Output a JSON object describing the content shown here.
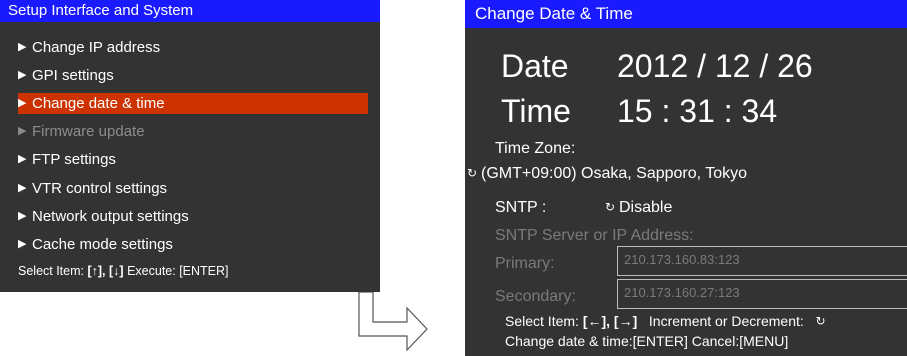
{
  "left_panel": {
    "title": "Setup Interface and System",
    "items": [
      {
        "label": "Change IP address",
        "selected": false,
        "disabled": false
      },
      {
        "label": "GPI settings",
        "selected": false,
        "disabled": false
      },
      {
        "label": "Change date & time",
        "selected": true,
        "disabled": false
      },
      {
        "label": "Firmware update",
        "selected": false,
        "disabled": true
      },
      {
        "label": "FTP settings",
        "selected": false,
        "disabled": false
      },
      {
        "label": "VTR control settings",
        "selected": false,
        "disabled": false
      },
      {
        "label": "Network output settings",
        "selected": false,
        "disabled": false
      },
      {
        "label": "Cache mode settings",
        "selected": false,
        "disabled": false
      }
    ],
    "footer": {
      "select_label": "Select Item:",
      "select_keys": "[↑], [↓]",
      "execute_label": "Execute: [ENTER]"
    }
  },
  "right_panel": {
    "title": "Change Date & Time",
    "date_label": "Date",
    "date_value": "2012 / 12 / 26",
    "time_label": "Time",
    "time_value": "15 : 31 : 34",
    "time_zone_label": "Time Zone:",
    "time_zone_value": "(GMT+09:00) Osaka, Sapporo, Tokyo",
    "sntp_label": "SNTP :",
    "sntp_value": "Disable",
    "server_label": "SNTP Server or IP Address:",
    "primary_label": "Primary:",
    "primary_value": "210.173.160.83:123",
    "secondary_label": "Secondary:",
    "secondary_value": "210.173.160.27:123",
    "footer": {
      "select_label": "Select Item:",
      "select_keys": "[←], [→]",
      "increment_label": "Increment or Decrement:",
      "line2": "Change date & time:[ENTER]   Cancel:[MENU]"
    }
  },
  "colors": {
    "titlebar": "#1a1aff",
    "panel_bg": "#333333",
    "selected": "#cc3300",
    "disabled": "#8c8c8c"
  },
  "icons": {
    "menu_arrow": "right-triangle-icon",
    "spinner": "spin-cycle-icon",
    "flow": "down-right-arrow-icon"
  }
}
